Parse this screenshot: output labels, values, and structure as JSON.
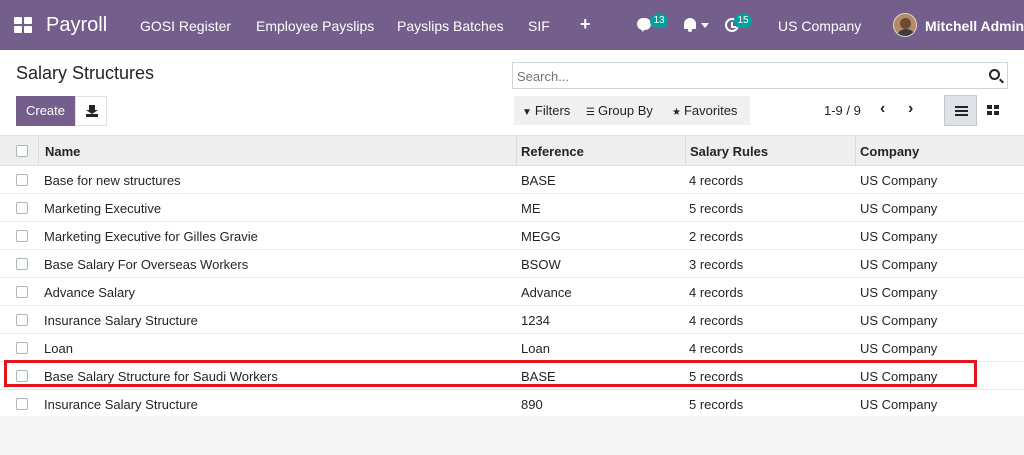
{
  "navbar": {
    "app_name": "Payroll",
    "menu": [
      "GOSI Register",
      "Employee Payslips",
      "Payslips Batches",
      "SIF"
    ],
    "plus_label": "+",
    "messages_count": "13",
    "activities_count": "15",
    "company": "US Company",
    "user": "Mitchell Admin"
  },
  "control_panel": {
    "title": "Salary Structures",
    "search_placeholder": "Search...",
    "create_label": "Create",
    "filters_label": "Filters",
    "group_by_label": "Group By",
    "favorites_label": "Favorites",
    "pager": "1-9 / 9"
  },
  "table": {
    "columns": [
      "Name",
      "Reference",
      "Salary Rules",
      "Company"
    ],
    "rows": [
      {
        "name": "Base for new structures",
        "reference": "BASE",
        "rules": "4 records",
        "company": "US Company"
      },
      {
        "name": "Marketing Executive",
        "reference": "ME",
        "rules": "5 records",
        "company": "US Company"
      },
      {
        "name": "Marketing Executive for Gilles Gravie",
        "reference": "MEGG",
        "rules": "2 records",
        "company": "US Company"
      },
      {
        "name": "Base Salary For Overseas Workers",
        "reference": "BSOW",
        "rules": "3 records",
        "company": "US Company"
      },
      {
        "name": "Advance Salary",
        "reference": "Advance",
        "rules": "4 records",
        "company": "US Company"
      },
      {
        "name": "Insurance Salary Structure",
        "reference": "1234",
        "rules": "4 records",
        "company": "US Company"
      },
      {
        "name": "Loan",
        "reference": "Loan",
        "rules": "4 records",
        "company": "US Company"
      },
      {
        "name": "Base Salary Structure for Saudi Workers",
        "reference": "BASE",
        "rules": "5 records",
        "company": "US Company"
      },
      {
        "name": "Insurance Salary Structure",
        "reference": "890",
        "rules": "5 records",
        "company": "US Company"
      }
    ]
  },
  "colors": {
    "brand": "#735e8c",
    "badge": "#00a09d",
    "highlight": "#e3141d"
  }
}
